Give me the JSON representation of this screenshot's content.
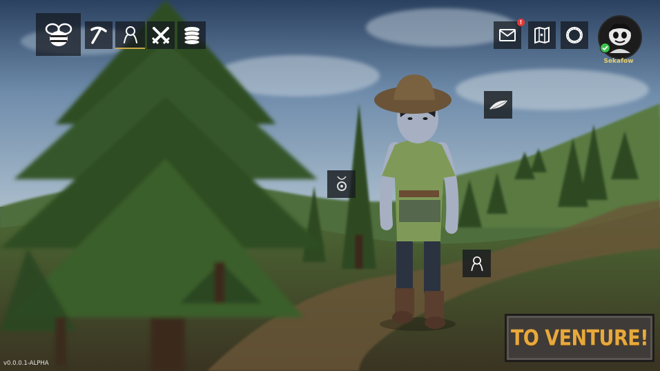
{
  "nav": {
    "items": [
      {
        "name": "bee-colony",
        "icon": "bee-icon"
      },
      {
        "name": "mining",
        "icon": "pickaxe-icon"
      },
      {
        "name": "character",
        "icon": "person-icon",
        "active": true
      },
      {
        "name": "combat",
        "icon": "crossed-swords-icon"
      },
      {
        "name": "coins",
        "icon": "coin-stack-icon"
      }
    ]
  },
  "topbar": {
    "mail_badge": "!",
    "icons": [
      "mail-icon",
      "map-icon",
      "ring-icon"
    ]
  },
  "profile": {
    "username": "Sekafow",
    "status_color": "#3fbf4a"
  },
  "equipment_slots": [
    {
      "name": "feather-slot",
      "icon": "feather-icon"
    },
    {
      "name": "amulet-slot",
      "icon": "amulet-icon"
    },
    {
      "name": "appearance-slot",
      "icon": "person-icon"
    }
  ],
  "venture_button": {
    "label": "TO VENTURE!"
  },
  "version": "v0.0.0.1-ALPHA",
  "colors": {
    "accent": "#e8a93c",
    "username": "#e9cf6a",
    "alert": "#e53935"
  }
}
